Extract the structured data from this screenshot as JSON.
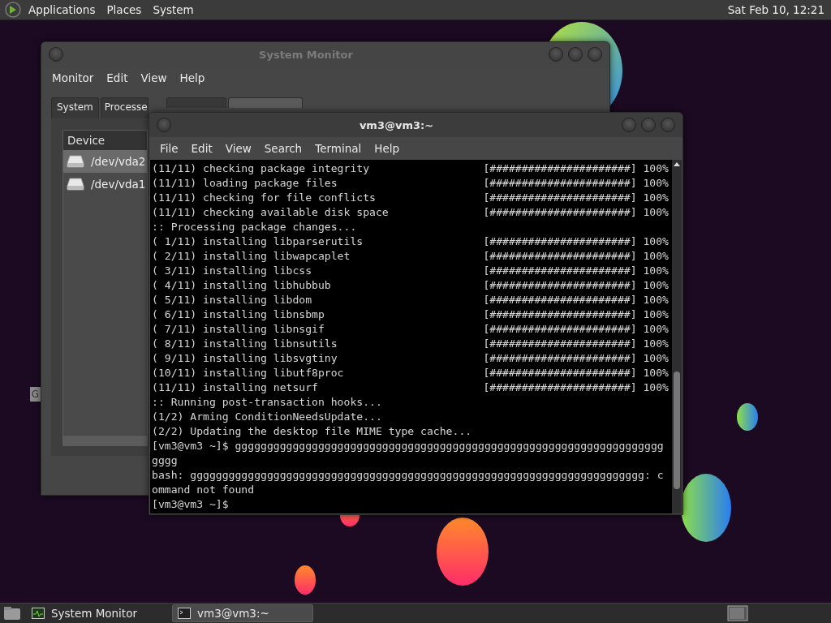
{
  "top_panel": {
    "menus": [
      "Applications",
      "Places",
      "System"
    ],
    "clock": "Sat Feb 10, 12:21"
  },
  "desktop_label": "G",
  "system_monitor": {
    "title": "System Monitor",
    "menus": [
      "Monitor",
      "Edit",
      "View",
      "Help"
    ],
    "tabs": [
      {
        "label": "System",
        "selected": false
      },
      {
        "label": "Processe",
        "selected": false
      },
      {
        "selected": false
      },
      {
        "selected": true
      }
    ],
    "column": "Device",
    "devices": [
      {
        "name": "/dev/vda2",
        "selected": true
      },
      {
        "name": "/dev/vda1",
        "selected": false
      }
    ]
  },
  "terminal": {
    "title": "vm3@vm3:~",
    "menus": [
      "File",
      "Edit",
      "View",
      "Search",
      "Terminal",
      "Help"
    ],
    "lines": [
      {
        "text": "(11/11) checking package integrity",
        "bar": "[######################] 100%"
      },
      {
        "text": "(11/11) loading package files",
        "bar": "[######################] 100%"
      },
      {
        "text": "(11/11) checking for file conflicts",
        "bar": "[######################] 100%"
      },
      {
        "text": "(11/11) checking available disk space",
        "bar": "[######################] 100%"
      },
      {
        "text": ":: Processing package changes..."
      },
      {
        "text": "( 1/11) installing libparserutils",
        "bar": "[######################] 100%"
      },
      {
        "text": "( 2/11) installing libwapcaplet",
        "bar": "[######################] 100%"
      },
      {
        "text": "( 3/11) installing libcss",
        "bar": "[######################] 100%"
      },
      {
        "text": "( 4/11) installing libhubbub",
        "bar": "[######################] 100%"
      },
      {
        "text": "( 5/11) installing libdom",
        "bar": "[######################] 100%"
      },
      {
        "text": "( 6/11) installing libnsbmp",
        "bar": "[######################] 100%"
      },
      {
        "text": "( 7/11) installing libnsgif",
        "bar": "[######################] 100%"
      },
      {
        "text": "( 8/11) installing libnsutils",
        "bar": "[######################] 100%"
      },
      {
        "text": "( 9/11) installing libsvgtiny",
        "bar": "[######################] 100%"
      },
      {
        "text": "(10/11) installing libutf8proc",
        "bar": "[######################] 100%"
      },
      {
        "text": "(11/11) installing netsurf",
        "bar": "[######################] 100%"
      },
      {
        "text": ":: Running post-transaction hooks..."
      },
      {
        "text": "(1/2) Arming ConditionNeedsUpdate..."
      },
      {
        "text": "(2/2) Updating the desktop file MIME type cache..."
      },
      {
        "text": "[vm3@vm3 ~]$ ggggggggggggggggggggggggggggggggggggggggggggggggggggggggggggggggggg"
      },
      {
        "text": "gggg"
      },
      {
        "text": "bash: ggggggggggggggggggggggggggggggggggggggggggggggggggggggggggggggggggggggg: c"
      },
      {
        "text": "ommand not found"
      },
      {
        "text": "[vm3@vm3 ~]$"
      }
    ]
  },
  "taskbar": {
    "items": [
      {
        "label": "System Monitor",
        "selected": false,
        "kind": "monitor"
      },
      {
        "label": "vm3@vm3:~",
        "selected": true,
        "kind": "terminal"
      }
    ]
  }
}
